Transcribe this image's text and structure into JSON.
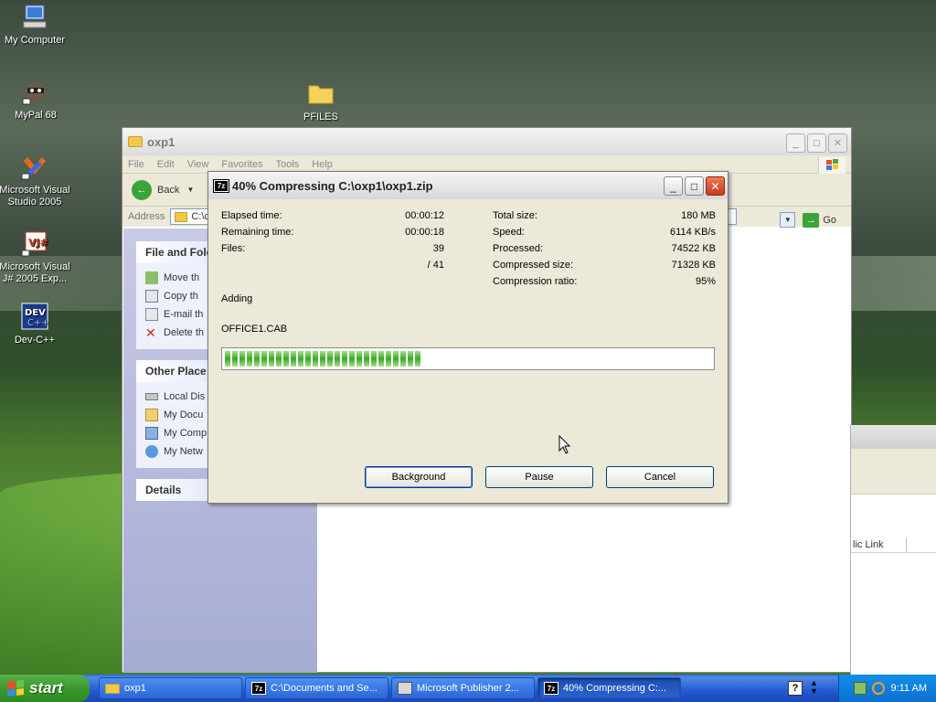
{
  "desktop": {
    "icons": [
      {
        "label": "My Computer"
      },
      {
        "label": "MyPal 68"
      },
      {
        "label": "Microsoft Visual Studio 2005"
      },
      {
        "label": "Microsoft Visual J# 2005 Exp..."
      },
      {
        "label": "Dev-C++"
      },
      {
        "label": "PFILES"
      }
    ]
  },
  "explorer": {
    "title": "oxp1",
    "menu": [
      "File",
      "Edit",
      "View",
      "Favorites",
      "Tools",
      "Help"
    ],
    "back_label": "Back",
    "address_label": "Address",
    "address_value": "C:\\o",
    "go_label": "Go",
    "file_folder_tasks": {
      "title": "File and Fold",
      "items": [
        "Move th",
        "Copy th",
        "E-mail th",
        "Delete th"
      ]
    },
    "other_places": {
      "title": "Other Place",
      "items": [
        "Local Dis",
        "My Docu",
        "My Comp",
        "My Netw"
      ]
    },
    "details": {
      "title": "Details"
    }
  },
  "bg_window": {
    "column_label": "lic Link"
  },
  "dialog": {
    "title": "40% Compressing C:\\oxp1\\oxp1.zip",
    "icon_text": "7z",
    "left_stats": [
      {
        "label": "Elapsed time:",
        "value": "00:00:12"
      },
      {
        "label": "Remaining time:",
        "value": "00:00:18"
      },
      {
        "label": "Files:",
        "value": "39"
      },
      {
        "label": "",
        "value": "/ 41"
      }
    ],
    "right_stats": [
      {
        "label": "Total size:",
        "value": "180 MB"
      },
      {
        "label": "Speed:",
        "value": "6114 KB/s"
      },
      {
        "label": "Processed:",
        "value": "74522 KB"
      },
      {
        "label": "Compressed size:",
        "value": "71328 KB"
      },
      {
        "label": "Compression ratio:",
        "value": "95%"
      }
    ],
    "action": "Adding",
    "current_file": "OFFICE1.CAB",
    "progress": 0.4,
    "buttons": {
      "background": "Background",
      "pause": "Pause",
      "cancel": "Cancel"
    }
  },
  "taskbar": {
    "start_label": "start",
    "tasks": [
      {
        "label": "oxp1"
      },
      {
        "label": "C:\\Documents and Se..."
      },
      {
        "label": "Microsoft Publisher 2..."
      },
      {
        "label": "40% Compressing C:..."
      }
    ],
    "clock": "9:11 AM",
    "help_label": "?"
  }
}
